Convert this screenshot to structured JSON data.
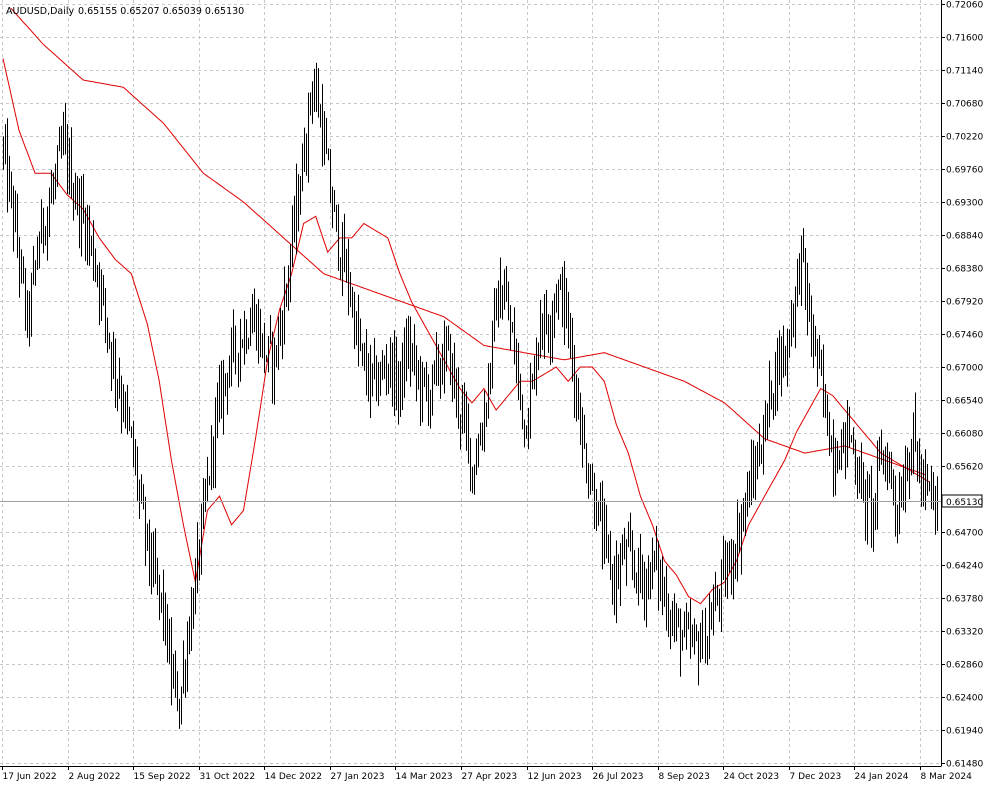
{
  "header": {
    "symbol": "AUDUSD,Daily",
    "ohlc": "0.65155 0.65207 0.65039 0.65130"
  },
  "current_price_label": "0.65130",
  "colors": {
    "background": "#ffffff",
    "bars": "#000000",
    "grid": "#c8c8c8",
    "ma_fast": "#e00000",
    "ma_slow": "#e00000",
    "price_line": "#a0a0a0"
  },
  "chart_data": {
    "type": "ohlc-bar",
    "title": "AUDUSD,Daily",
    "grid": true,
    "ylim": [
      0.6148,
      0.7206
    ],
    "y_ticks": [
      "0.72060",
      "0.71600",
      "0.71140",
      "0.70680",
      "0.70220",
      "0.69760",
      "0.69300",
      "0.68840",
      "0.68380",
      "0.67920",
      "0.67460",
      "0.67000",
      "0.66540",
      "0.66080",
      "0.65620",
      "0.65130",
      "0.64700",
      "0.64240",
      "0.63780",
      "0.63320",
      "0.62860",
      "0.62400",
      "0.61940",
      "0.61480"
    ],
    "x_ticks": [
      "17 Jun 2022",
      "2 Aug 2022",
      "15 Sep 2022",
      "31 Oct 2022",
      "14 Dec 2022",
      "27 Jan 2023",
      "14 Mar 2023",
      "27 Apr 2023",
      "12 Jun 2023",
      "26 Jul 2023",
      "8 Sep 2023",
      "24 Oct 2023",
      "7 Dec 2023",
      "24 Jan 2024",
      "8 Mar 2024"
    ],
    "close_anchor_points": [
      [
        0,
        0.7
      ],
      [
        6,
        0.689
      ],
      [
        12,
        0.676
      ],
      [
        18,
        0.688
      ],
      [
        25,
        0.695
      ],
      [
        30,
        0.701
      ],
      [
        36,
        0.694
      ],
      [
        42,
        0.689
      ],
      [
        48,
        0.682
      ],
      [
        54,
        0.672
      ],
      [
        60,
        0.665
      ],
      [
        66,
        0.656
      ],
      [
        70,
        0.648
      ],
      [
        75,
        0.641
      ],
      [
        80,
        0.636
      ],
      [
        84,
        0.627
      ],
      [
        88,
        0.623
      ],
      [
        92,
        0.632
      ],
      [
        96,
        0.64
      ],
      [
        100,
        0.649
      ],
      [
        105,
        0.66
      ],
      [
        110,
        0.668
      ],
      [
        115,
        0.672
      ],
      [
        120,
        0.675
      ],
      [
        125,
        0.677
      ],
      [
        130,
        0.672
      ],
      [
        135,
        0.671
      ],
      [
        140,
        0.679
      ],
      [
        145,
        0.69
      ],
      [
        150,
        0.7
      ],
      [
        154,
        0.71
      ],
      [
        158,
        0.705
      ],
      [
        163,
        0.694
      ],
      [
        168,
        0.686
      ],
      [
        172,
        0.682
      ],
      [
        177,
        0.673
      ],
      [
        182,
        0.668
      ],
      [
        187,
        0.668
      ],
      [
        192,
        0.671
      ],
      [
        197,
        0.667
      ],
      [
        202,
        0.673
      ],
      [
        207,
        0.668
      ],
      [
        212,
        0.666
      ],
      [
        217,
        0.67
      ],
      [
        222,
        0.672
      ],
      [
        226,
        0.666
      ],
      [
        230,
        0.662
      ],
      [
        234,
        0.656
      ],
      [
        238,
        0.66
      ],
      [
        242,
        0.668
      ],
      [
        246,
        0.679
      ],
      [
        250,
        0.68
      ],
      [
        255,
        0.672
      ],
      [
        260,
        0.662
      ],
      [
        264,
        0.667
      ],
      [
        268,
        0.677
      ],
      [
        272,
        0.676
      ],
      [
        276,
        0.681
      ],
      [
        280,
        0.679
      ],
      [
        285,
        0.669
      ],
      [
        290,
        0.658
      ],
      [
        295,
        0.652
      ],
      [
        300,
        0.645
      ],
      [
        305,
        0.64
      ],
      [
        310,
        0.644
      ],
      [
        315,
        0.642
      ],
      [
        320,
        0.64
      ],
      [
        325,
        0.643
      ],
      [
        330,
        0.638
      ],
      [
        335,
        0.634
      ],
      [
        340,
        0.632
      ],
      [
        345,
        0.631
      ],
      [
        350,
        0.632
      ],
      [
        355,
        0.637
      ],
      [
        360,
        0.641
      ],
      [
        365,
        0.645
      ],
      [
        370,
        0.651
      ],
      [
        375,
        0.656
      ],
      [
        380,
        0.662
      ],
      [
        385,
        0.67
      ],
      [
        390,
        0.672
      ],
      [
        395,
        0.68
      ],
      [
        398,
        0.686
      ],
      [
        402,
        0.676
      ],
      [
        406,
        0.671
      ],
      [
        410,
        0.664
      ],
      [
        414,
        0.658
      ],
      [
        418,
        0.659
      ],
      [
        422,
        0.661
      ],
      [
        426,
        0.656
      ],
      [
        430,
        0.651
      ],
      [
        434,
        0.65
      ],
      [
        438,
        0.658
      ],
      [
        442,
        0.656
      ],
      [
        446,
        0.65
      ],
      [
        450,
        0.656
      ],
      [
        454,
        0.66
      ],
      [
        458,
        0.654
      ],
      [
        462,
        0.652
      ],
      [
        466,
        0.65
      ]
    ],
    "ma_fast_points": [
      [
        0,
        0.713
      ],
      [
        8,
        0.703
      ],
      [
        16,
        0.697
      ],
      [
        24,
        0.697
      ],
      [
        32,
        0.694
      ],
      [
        40,
        0.692
      ],
      [
        48,
        0.688
      ],
      [
        56,
        0.685
      ],
      [
        64,
        0.683
      ],
      [
        72,
        0.676
      ],
      [
        78,
        0.668
      ],
      [
        84,
        0.657
      ],
      [
        90,
        0.648
      ],
      [
        96,
        0.64
      ],
      [
        102,
        0.65
      ],
      [
        108,
        0.652
      ],
      [
        114,
        0.648
      ],
      [
        120,
        0.65
      ],
      [
        126,
        0.66
      ],
      [
        132,
        0.671
      ],
      [
        138,
        0.678
      ],
      [
        144,
        0.683
      ],
      [
        150,
        0.69
      ],
      [
        156,
        0.691
      ],
      [
        162,
        0.686
      ],
      [
        168,
        0.688
      ],
      [
        174,
        0.688
      ],
      [
        180,
        0.69
      ],
      [
        186,
        0.689
      ],
      [
        192,
        0.688
      ],
      [
        198,
        0.683
      ],
      [
        204,
        0.679
      ],
      [
        210,
        0.676
      ],
      [
        216,
        0.673
      ],
      [
        222,
        0.67
      ],
      [
        228,
        0.667
      ],
      [
        234,
        0.665
      ],
      [
        240,
        0.667
      ],
      [
        246,
        0.664
      ],
      [
        252,
        0.666
      ],
      [
        258,
        0.668
      ],
      [
        264,
        0.668
      ],
      [
        270,
        0.669
      ],
      [
        276,
        0.67
      ],
      [
        282,
        0.668
      ],
      [
        288,
        0.67
      ],
      [
        294,
        0.67
      ],
      [
        300,
        0.668
      ],
      [
        306,
        0.662
      ],
      [
        312,
        0.658
      ],
      [
        318,
        0.652
      ],
      [
        324,
        0.648
      ],
      [
        330,
        0.643
      ],
      [
        336,
        0.641
      ],
      [
        342,
        0.638
      ],
      [
        348,
        0.637
      ],
      [
        354,
        0.639
      ],
      [
        360,
        0.64
      ],
      [
        366,
        0.643
      ],
      [
        372,
        0.648
      ],
      [
        378,
        0.651
      ],
      [
        384,
        0.654
      ],
      [
        390,
        0.657
      ],
      [
        396,
        0.661
      ],
      [
        402,
        0.664
      ],
      [
        408,
        0.667
      ],
      [
        414,
        0.666
      ],
      [
        420,
        0.664
      ],
      [
        426,
        0.662
      ],
      [
        432,
        0.66
      ],
      [
        438,
        0.658
      ],
      [
        444,
        0.657
      ],
      [
        450,
        0.656
      ],
      [
        456,
        0.655
      ],
      [
        462,
        0.654
      ]
    ],
    "ma_slow_points": [
      [
        4,
        0.72
      ],
      [
        20,
        0.715
      ],
      [
        40,
        0.71
      ],
      [
        60,
        0.709
      ],
      [
        80,
        0.704
      ],
      [
        100,
        0.697
      ],
      [
        120,
        0.693
      ],
      [
        140,
        0.688
      ],
      [
        160,
        0.683
      ],
      [
        180,
        0.681
      ],
      [
        200,
        0.679
      ],
      [
        220,
        0.677
      ],
      [
        240,
        0.673
      ],
      [
        260,
        0.672
      ],
      [
        280,
        0.671
      ],
      [
        300,
        0.672
      ],
      [
        320,
        0.67
      ],
      [
        340,
        0.668
      ],
      [
        360,
        0.665
      ],
      [
        380,
        0.66
      ],
      [
        400,
        0.658
      ],
      [
        420,
        0.659
      ],
      [
        440,
        0.657
      ],
      [
        460,
        0.655
      ]
    ],
    "n_bars": 467
  }
}
